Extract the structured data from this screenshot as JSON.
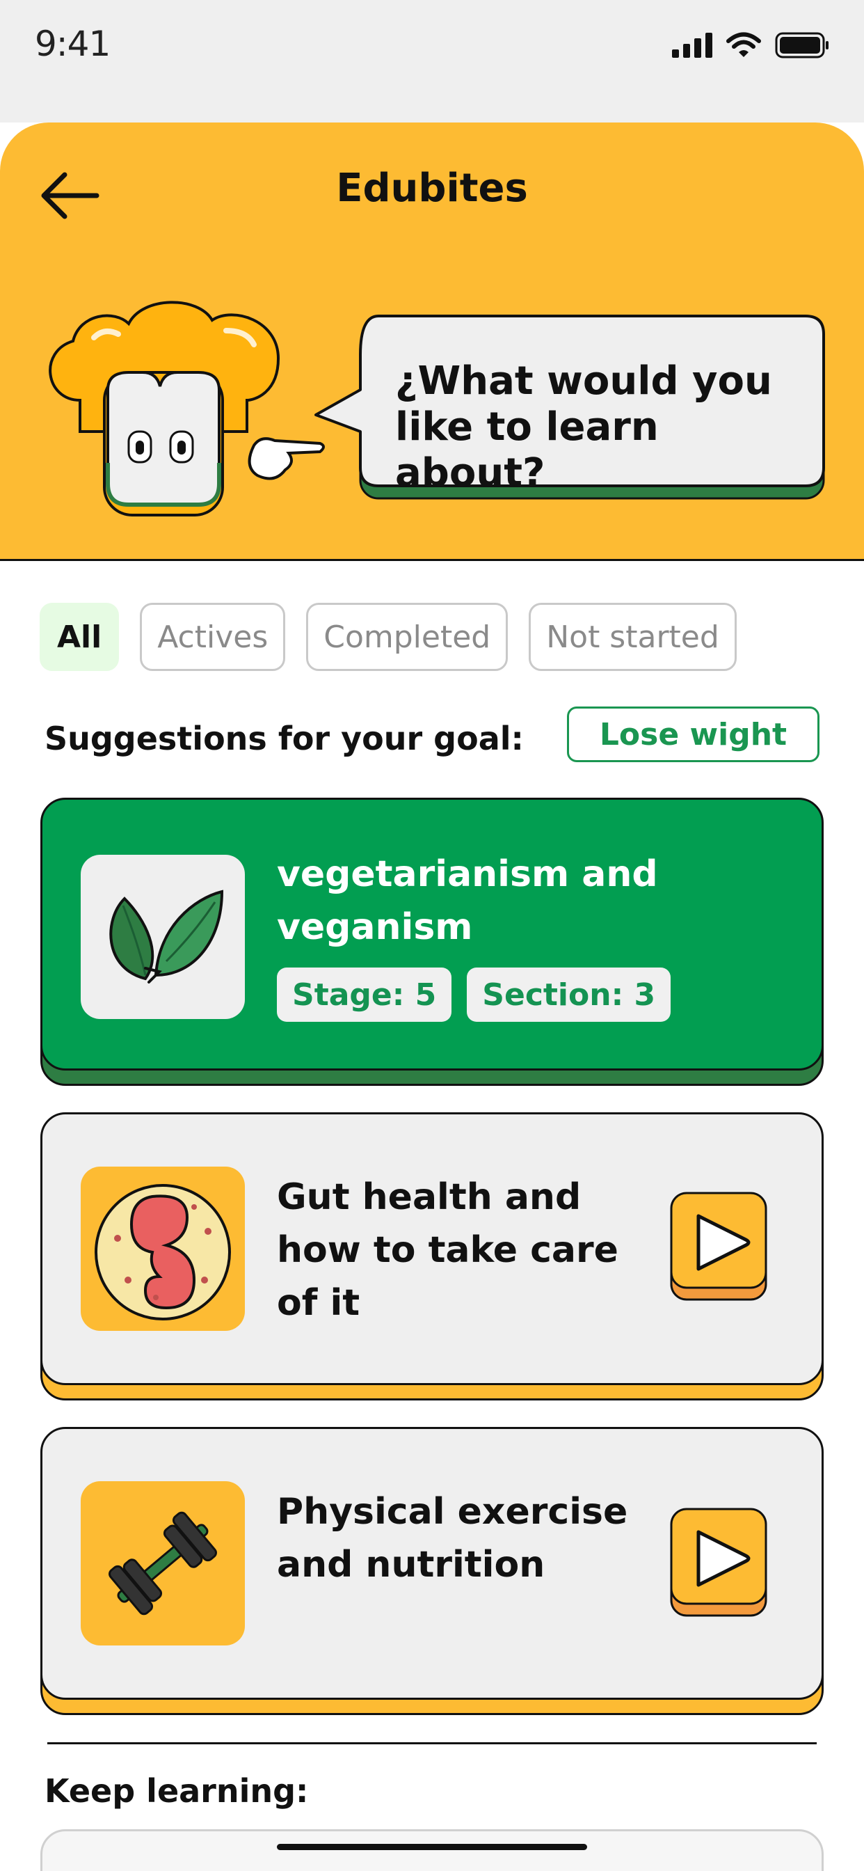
{
  "status_bar": {
    "time": "9:41"
  },
  "header": {
    "back_icon": "arrow-left-icon",
    "title": "Edubites",
    "prompt": "¿What would you like to learn about?",
    "background": "#fdbb33"
  },
  "filters": [
    {
      "label": "All",
      "selected": true
    },
    {
      "label": "Actives",
      "selected": false
    },
    {
      "label": "Completed",
      "selected": false
    },
    {
      "label": "Not started",
      "selected": false
    }
  ],
  "goal": {
    "label": "Suggestions for your goal:",
    "value": "Lose wight"
  },
  "cards": [
    {
      "title": "vegetarianism and veganism",
      "stage": "Stage: 5",
      "section": "Section: 3",
      "icon": "leaves-icon",
      "color": "#029e51"
    },
    {
      "title": "Gut health and how to take care of it",
      "icon": "gut-icon",
      "action_icon": "play-icon",
      "color": "#fdbb33"
    },
    {
      "title": "Physical exercise and nutrition",
      "icon": "dumbbell-icon",
      "action_icon": "play-icon",
      "color": "#fdbb33"
    }
  ],
  "keep_learning": {
    "label": "Keep learning:"
  },
  "colors": {
    "accent_green": "#029e51",
    "accent_yellow": "#fdbb33",
    "dark_green": "#2e7d43",
    "orange": "#f39a3d"
  }
}
